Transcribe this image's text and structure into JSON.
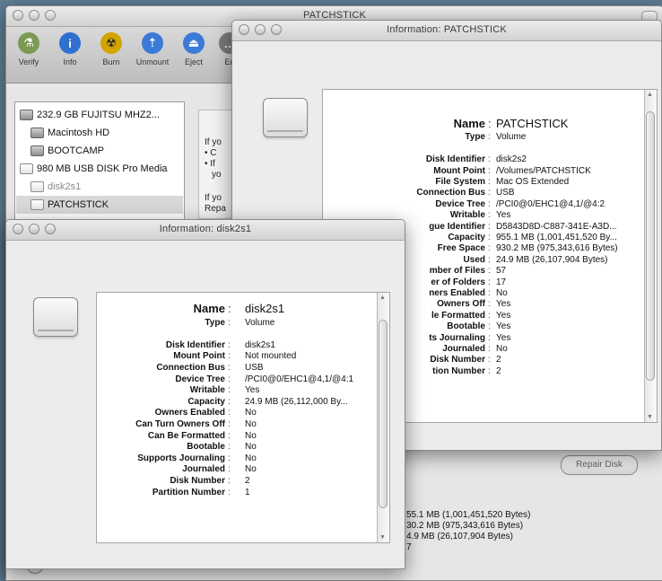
{
  "main_window": {
    "title": "PATCHSTICK",
    "toolbar": [
      {
        "label": "Verify",
        "icon": "microscope-icon",
        "color": "#6f8e4a",
        "glyph": "⚗"
      },
      {
        "label": "Info",
        "icon": "info-icon",
        "color": "#2e6fcf",
        "glyph": "i"
      },
      {
        "label": "Burn",
        "icon": "burn-icon",
        "color": "#d2a400",
        "glyph": "☢"
      },
      {
        "label": "Unmount",
        "icon": "unmount-icon",
        "color": "#3b7ad6",
        "glyph": "⇡"
      },
      {
        "label": "Eject",
        "icon": "eject-icon",
        "color": "#3b7ad6",
        "glyph": "⏏"
      },
      {
        "label": "En",
        "icon": "enable-journaling-icon",
        "color": "#7a7a7a",
        "glyph": "…"
      }
    ],
    "disks": [
      {
        "label": "232.9 GB FUJITSU MHZ2...",
        "level": 0,
        "icon": "hard-disk-icon"
      },
      {
        "label": "Macintosh HD",
        "level": 1,
        "icon": "volume-icon"
      },
      {
        "label": "BOOTCAMP",
        "level": 1,
        "icon": "volume-icon"
      },
      {
        "label": "980 MB USB DISK Pro Media",
        "level": 0,
        "icon": "usb-disk-icon"
      },
      {
        "label": "disk2s1",
        "level": 1,
        "icon": "volume-icon",
        "dim": true
      },
      {
        "label": "PATCHSTICK",
        "level": 1,
        "icon": "volume-icon",
        "selected": true
      }
    ],
    "first_aid_lines": [
      "If yo",
      "• C",
      "• If",
      "yo",
      "If yo",
      "Repa"
    ],
    "repair_disk_label": "Repair Disk",
    "info_lines": [
      "55.1 MB (1,001,451,520 Bytes)",
      "30.2 MB (975,343,616 Bytes)",
      "4.9 MB (26,107,904 Bytes)",
      "7"
    ]
  },
  "patch_panel": {
    "title": "Information: PATCHSTICK",
    "rows": [
      {
        "key": "Name",
        "value": "PATCHSTICK",
        "big": true
      },
      {
        "key": "Type",
        "value": "Volume"
      },
      {
        "key": "",
        "value": ""
      },
      {
        "key": "Disk Identifier",
        "value": "disk2s2"
      },
      {
        "key": "Mount Point",
        "value": "/Volumes/PATCHSTICK"
      },
      {
        "key": "File System",
        "value": "Mac OS Extended"
      },
      {
        "key": "Connection Bus",
        "value": "USB"
      },
      {
        "key": "Device Tree",
        "value": "/PCI0@0/EHC1@4,1/@4:2"
      },
      {
        "key": "Writable",
        "value": "Yes"
      },
      {
        "key": "gue Identifier",
        "value": "D5843D8D-C887-341E-A3D..."
      },
      {
        "key": "Capacity",
        "value": "955.1 MB (1,001,451,520 By..."
      },
      {
        "key": "Free Space",
        "value": "930.2 MB (975,343,616 Bytes)"
      },
      {
        "key": "Used",
        "value": "24.9 MB (26,107,904 Bytes)"
      },
      {
        "key": "mber of Files",
        "value": "57"
      },
      {
        "key": "er of Folders",
        "value": "17"
      },
      {
        "key": "ners Enabled",
        "value": "No"
      },
      {
        "key": "Owners Off",
        "value": "Yes"
      },
      {
        "key": "le Formatted",
        "value": "Yes"
      },
      {
        "key": "Bootable",
        "value": "Yes"
      },
      {
        "key": "ts Journaling",
        "value": "Yes"
      },
      {
        "key": "Journaled",
        "value": "No"
      },
      {
        "key": "Disk Number",
        "value": "2"
      },
      {
        "key": "tion Number",
        "value": "2"
      }
    ]
  },
  "disk_panel": {
    "title": "Information: disk2s1",
    "rows": [
      {
        "key": "Name",
        "value": "disk2s1",
        "big": true
      },
      {
        "key": "Type",
        "value": "Volume"
      },
      {
        "key": "",
        "value": ""
      },
      {
        "key": "Disk Identifier",
        "value": "disk2s1"
      },
      {
        "key": "Mount Point",
        "value": "Not mounted"
      },
      {
        "key": "Connection Bus",
        "value": "USB"
      },
      {
        "key": "Device Tree",
        "value": "/PCI0@0/EHC1@4,1/@4:1"
      },
      {
        "key": "Writable",
        "value": "Yes"
      },
      {
        "key": "Capacity",
        "value": "24.9 MB (26,112,000 By..."
      },
      {
        "key": "Owners Enabled",
        "value": "No"
      },
      {
        "key": "Can Turn Owners Off",
        "value": "No"
      },
      {
        "key": "Can Be Formatted",
        "value": "No"
      },
      {
        "key": "Bootable",
        "value": "No"
      },
      {
        "key": "Supports Journaling",
        "value": "No"
      },
      {
        "key": "Journaled",
        "value": "No"
      },
      {
        "key": "Disk Number",
        "value": "2"
      },
      {
        "key": "Partition Number",
        "value": "1"
      }
    ]
  }
}
